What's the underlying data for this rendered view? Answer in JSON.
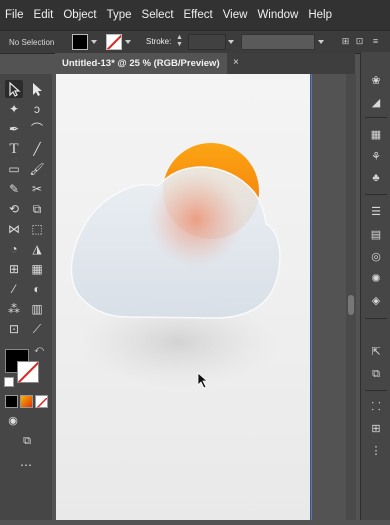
{
  "menu": [
    "File",
    "Edit",
    "Object",
    "Type",
    "Select",
    "Effect",
    "View",
    "Window",
    "Help"
  ],
  "control_bar": {
    "selection_label": "No Selection",
    "stroke_label": "Stroke:"
  },
  "document_tab": {
    "title": "Untitled-13* @ 25 % (RGB/Preview)",
    "close_glyph": "×"
  },
  "colors": {
    "fill": "#000000",
    "stroke": "none",
    "artboard_edge": "#4a7ad8",
    "sun_top": "#fb9e12",
    "sun_bottom": "#e2510b",
    "cloud_glass": "#dfe6ee"
  },
  "icons": {
    "tools": [
      "selection-tool-icon",
      "direct-selection-tool-icon",
      "magic-wand-icon",
      "lasso-icon",
      "pen-tool-icon",
      "curvature-tool-icon",
      "type-tool-icon",
      "line-segment-icon",
      "rectangle-tool-icon",
      "paintbrush-icon",
      "pencil-icon",
      "scissors-icon",
      "rotate-icon",
      "scale-icon",
      "width-tool-icon",
      "free-transform-icon",
      "shape-builder-icon",
      "perspective-grid-icon",
      "mesh-icon",
      "gradient-icon",
      "eyedropper-icon",
      "blend-icon",
      "symbol-sprayer-icon",
      "column-graph-icon",
      "artboard-tool-icon",
      "slice-icon",
      "hand-icon",
      "zoom-icon"
    ],
    "panels": [
      "color-guide-icon",
      "color-icon",
      "swatches-icon",
      "brushes-icon",
      "symbols-icon",
      "stroke-icon",
      "gradient-panel-icon",
      "transparency-icon",
      "appearance-icon",
      "layers-icon",
      "export-icon",
      "artboards-panel-icon",
      "align-icon",
      "transform-icon",
      "properties-icon"
    ]
  }
}
